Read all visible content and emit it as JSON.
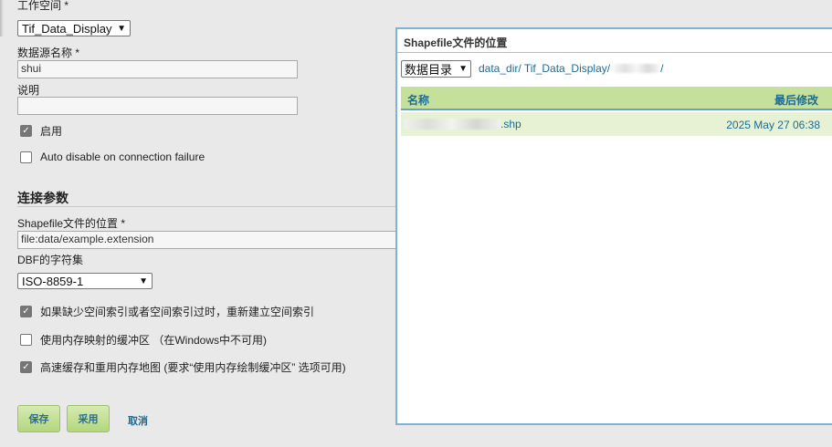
{
  "form": {
    "workspace_label": "工作空间 *",
    "workspace_value": "Tif_Data_Display",
    "datasource_label": "数据源名称 *",
    "datasource_value": "shui",
    "description_label": "说明",
    "description_value": "",
    "enabled_label": "启用",
    "enabled_checked": true,
    "auto_disable_label": "Auto disable on connection failure",
    "auto_disable_checked": false,
    "connection_section": "连接参数",
    "shapefile_label": "Shapefile文件的位置 *",
    "shapefile_value": "file:data/example.extension",
    "dbf_label": "DBF的字符集",
    "dbf_value": "ISO-8859-1",
    "rebuild_index_label": "如果缺少空间索引或者空间索引过时，重新建立空间索引",
    "rebuild_index_checked": true,
    "memory_mapped_label": "使用内存映射的缓冲区 （在Windows中不可用)",
    "memory_mapped_checked": false,
    "cache_label": "高速缓存和重用内存地图 (要求“使用内存绘制缓冲区” 选项可用)",
    "cache_checked": true,
    "save_label": "保存",
    "apply_label": "采用",
    "cancel_label": "取消"
  },
  "dialog": {
    "title": "Shapefile文件的位置",
    "root_select": "数据目录",
    "path_prefix": "data_dir/ Tif_Data_Display/",
    "path_suffix": "/",
    "col_name": "名称",
    "col_modified": "最后修改",
    "files": [
      {
        "name_suffix": ".shp",
        "modified": "2025 May 27 06:38"
      }
    ]
  }
}
